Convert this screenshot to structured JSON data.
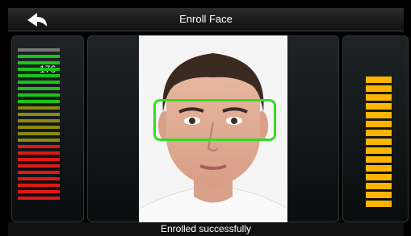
{
  "header": {
    "title": "Enroll Face"
  },
  "left_meter": {
    "value": "176",
    "level": 0.95
  },
  "right_meter": {
    "level": 1.0
  },
  "status": "Enrolled successfully",
  "colors": {
    "green": "#1cc21c",
    "olive": "#8a8a10",
    "red": "#e01818",
    "amber": "#ffb400",
    "frame": "#33dd22"
  }
}
